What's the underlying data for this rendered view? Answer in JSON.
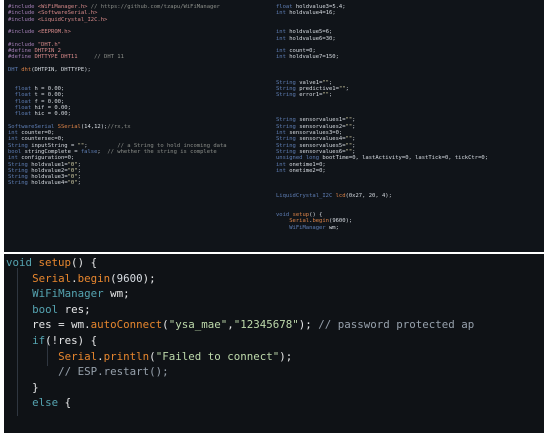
{
  "top_left_lines": [
    "#include <WiFiManager.h> // https://github.com/tzapu/WiFiManager",
    "#include <SoftwareSerial.h>",
    "#include <LiquidCrystal_I2C.h>",
    "",
    "#include <EEPROM.h>",
    "",
    "#include \"DHT.h\"",
    "#define DHTPIN 2",
    "#define DHTTYPE DHT11     // DHT 11",
    "",
    "DHT dht(DHTPIN, DHTTYPE);",
    "",
    "",
    "  float h = 0.00;",
    "  float t = 0.00;",
    "  float f = 0.00;",
    "  float hif = 0.00;",
    "  float hic = 0.00;",
    "",
    "SoftwareSerial SSerial(14,12);//rx,tx",
    "int counter=0;",
    "int countersec=0;",
    "String inputString = \"\";         // a String to hold incoming data",
    "bool stringComplete = false;  // whether the string is complete",
    "int configuration=0;",
    "String holdvalue1=\"0\";",
    "String holdvalue2=\"0\";",
    "String holdvalue3=\"0\";",
    "String holdvalue4=\"0\";"
  ],
  "top_right_lines": [
    "float holdvalue3=5.4;",
    "int holdvalue4=16;",
    "",
    "",
    "int holdvalue5=6;",
    "int holdvalue6=30;",
    "",
    "int count=0;",
    "int holdvalue7=150;",
    "",
    "",
    "",
    "String valve1=\"\";",
    "String predictive1=\"\";",
    "String error1=\"\";",
    "",
    "",
    "",
    "String sensorvalues1=\"\";",
    "String sensorvalues2=\"\";",
    "int sensorvalues3=0;",
    "String sensorvalues4=\"\";",
    "String sensorvalues5=\"\";",
    "String sensorvalues6=\"\";",
    "unsigned long bootTime=0, lastActivity=0, lastTick=0, tickCtr=0;",
    "int onetime1=0;",
    "int onetime2=0;",
    "",
    "",
    "",
    "LiquidCrystal_I2C lcd(0x27, 20, 4);",
    "",
    "",
    "void setup() {",
    "    Serial.begin(9600);",
    "    WiFiManager wm;"
  ],
  "bottom_lines": [
    "void setup() {",
    "    Serial.begin(9600);",
    "    WiFiManager wm;",
    "    bool res;",
    "    res = wm.autoConnect(\"ysa_mae\",\"12345678\"); // password protected ap",
    "    if(!res) {",
    "        Serial.println(\"Failed to connect\");",
    "        // ESP.restart();",
    "    }",
    "    else {"
  ]
}
